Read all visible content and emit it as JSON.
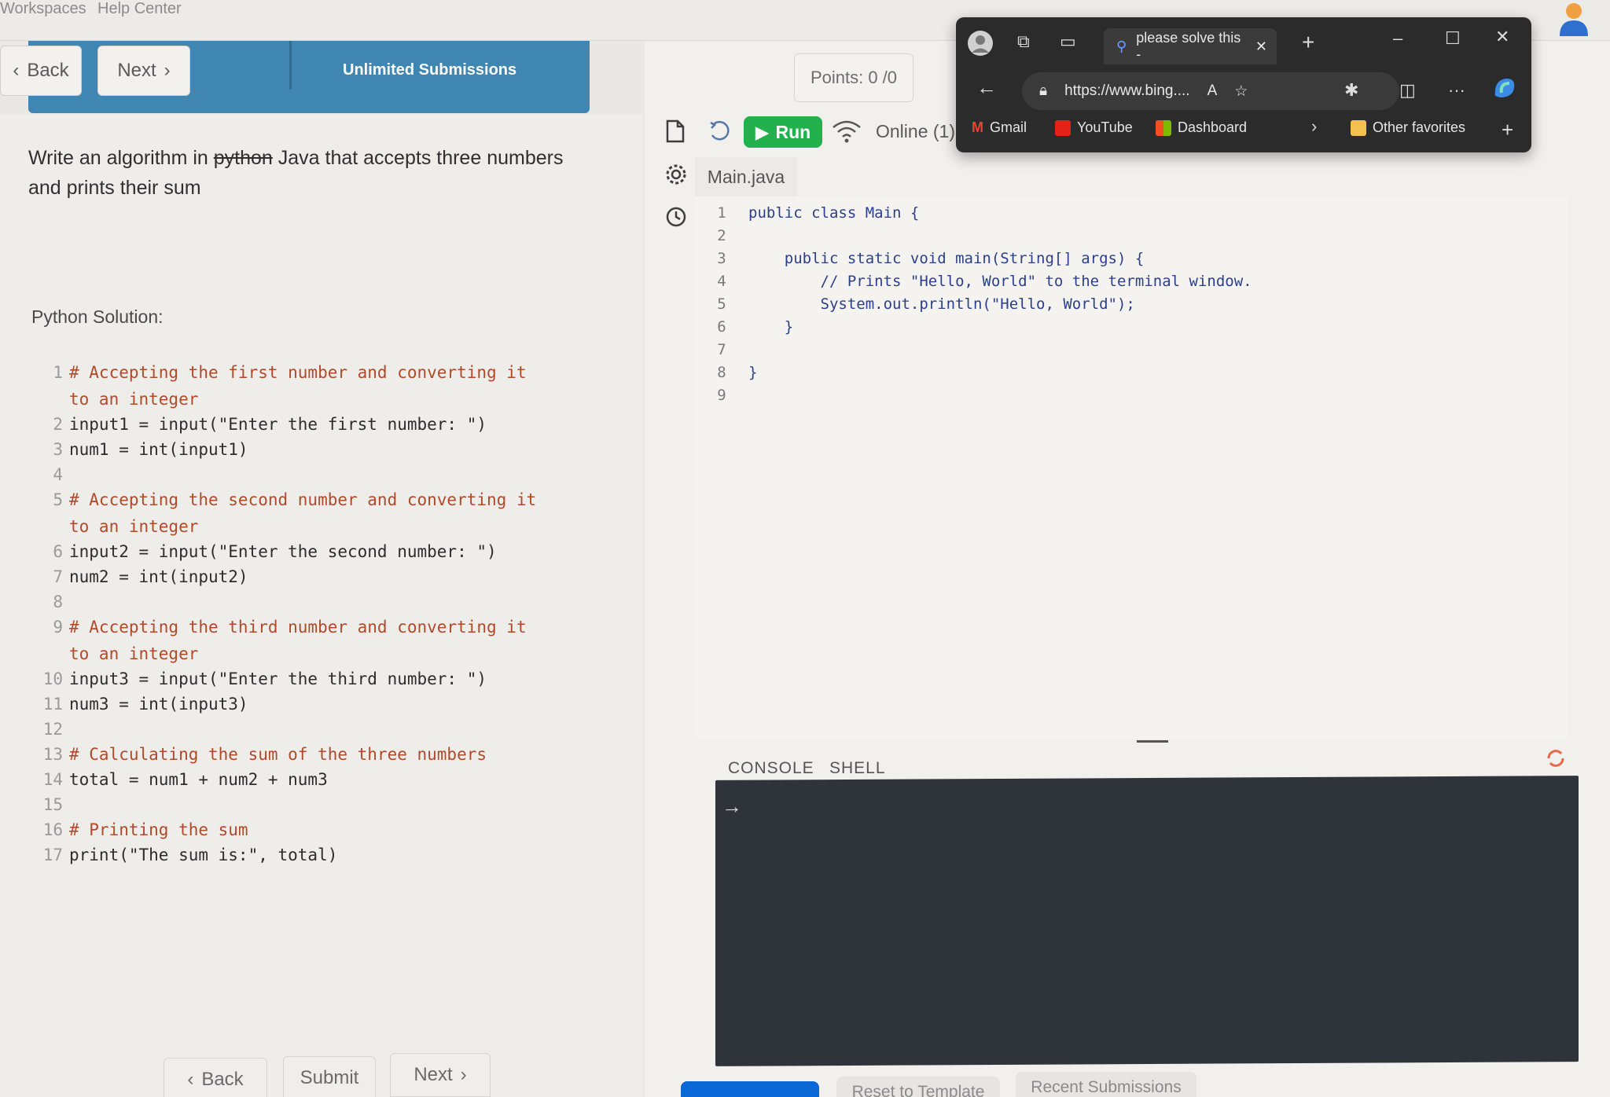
{
  "topnav": {
    "workspaces": "Workspaces",
    "help_center": "Help Center"
  },
  "header": {
    "back_label": "Back",
    "next_label": "Next",
    "submissions": "Unlimited Submissions",
    "points": "Points: 0 /0"
  },
  "question": {
    "prefix": "Write an algorithm in ",
    "struck": "python",
    "suffix": " Java that accepts three numbers and prints their sum"
  },
  "python_solution_label": "Python Solution:",
  "python_code": [
    {
      "n": "1",
      "text": "# Accepting the first number and converting it",
      "kind": "com"
    },
    {
      "n": "",
      "text": "to an integer",
      "kind": "com"
    },
    {
      "n": "2",
      "text": "input1 = input(\"Enter the first number: \")",
      "kind": "plain"
    },
    {
      "n": "3",
      "text": "num1 = int(input1)",
      "kind": "plain"
    },
    {
      "n": "4",
      "text": "",
      "kind": "plain"
    },
    {
      "n": "5",
      "text": "# Accepting the second number and converting it",
      "kind": "com"
    },
    {
      "n": "",
      "text": "to an integer",
      "kind": "com"
    },
    {
      "n": "6",
      "text": "input2 = input(\"Enter the second number: \")",
      "kind": "plain"
    },
    {
      "n": "7",
      "text": "num2 = int(input2)",
      "kind": "plain"
    },
    {
      "n": "8",
      "text": "",
      "kind": "plain"
    },
    {
      "n": "9",
      "text": "# Accepting the third number and converting it",
      "kind": "com"
    },
    {
      "n": "",
      "text": "to an integer",
      "kind": "com"
    },
    {
      "n": "10",
      "text": "input3 = input(\"Enter the third number: \")",
      "kind": "plain"
    },
    {
      "n": "11",
      "text": "num3 = int(input3)",
      "kind": "plain"
    },
    {
      "n": "12",
      "text": "",
      "kind": "plain"
    },
    {
      "n": "13",
      "text": "# Calculating the sum of the three numbers",
      "kind": "com"
    },
    {
      "n": "14",
      "text": "total = num1 + num2 + num3",
      "kind": "plain"
    },
    {
      "n": "15",
      "text": "",
      "kind": "plain"
    },
    {
      "n": "16",
      "text": "# Printing the sum",
      "kind": "com"
    },
    {
      "n": "17",
      "text": "print(\"The sum is:\", total)",
      "kind": "plain"
    }
  ],
  "footer_buttons": {
    "back": "Back",
    "submit": "Submit",
    "next": "Next"
  },
  "editor": {
    "run_label": "Run",
    "online_label": "Online (1)",
    "file_tab": "Main.java",
    "java_code": [
      {
        "n": "1",
        "text": "public class Main {"
      },
      {
        "n": "2",
        "text": ""
      },
      {
        "n": "3",
        "text": "    public static void main(String[] args) {"
      },
      {
        "n": "4",
        "text": "        // Prints \"Hello, World\" to the terminal window."
      },
      {
        "n": "5",
        "text": "        System.out.println(\"Hello, World\");"
      },
      {
        "n": "6",
        "text": "    }"
      },
      {
        "n": "7",
        "text": ""
      },
      {
        "n": "8",
        "text": "}"
      },
      {
        "n": "9",
        "text": ""
      }
    ],
    "console_tab": "CONSOLE",
    "shell_tab": "SHELL",
    "reset_label": "Reset to Template",
    "recent_label": "Recent Submissions"
  },
  "browser": {
    "tab_title": "please solve this -",
    "url": "https://www.bing....",
    "bookmarks": [
      "Gmail",
      "YouTube",
      "Dashboard"
    ],
    "other_favorites": "Other favorites"
  },
  "colors": {
    "accent_blue": "#3f86b2",
    "run_green": "#22b14c",
    "console_bg": "#2f343b"
  }
}
